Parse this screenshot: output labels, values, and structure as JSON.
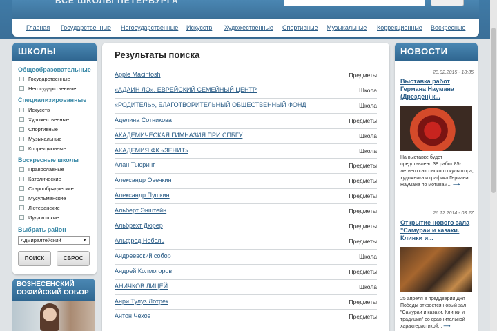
{
  "header": {
    "tagline": "ВСЕ ШКОЛЫ ПЕТЕРБУРГА",
    "search_value": "",
    "search_button": ""
  },
  "nav": [
    "Главная",
    "Государственные",
    "Негосударственные",
    "Искусств",
    "Художественные",
    "Спортивные",
    "Музыкальные",
    "Коррекционные",
    "Воскресные"
  ],
  "sidebar": {
    "title": "ШКОЛЫ",
    "groups": [
      {
        "title": "Общеобразовательные",
        "items": [
          "Государственные",
          "Негосударственные"
        ]
      },
      {
        "title": "Специализированные",
        "items": [
          "Искусств",
          "Художественные",
          "Спортивные",
          "Музыкальные",
          "Коррекционные"
        ]
      },
      {
        "title": "Воскресные школы",
        "items": [
          "Православные",
          "Католические",
          "Старообрядческие",
          "Мусульманские",
          "Лютеранские",
          "Иудаистские"
        ]
      }
    ],
    "district_label": "Выбрать район",
    "district_value": "Адмиралтейский",
    "search_button": "ПОИСК",
    "reset_button": "СБРОС"
  },
  "promo": {
    "title": "ВОЗНЕСЕНСКИЙ СОФИЙСКИЙ СОБОР"
  },
  "results": {
    "title": "Результаты поиска",
    "rows": [
      {
        "name": "Apple Macintosh",
        "type": "Предметы"
      },
      {
        "name": "«АДАИН ЛО», ЕВРЕЙСКИЙ СЕМЕЙНЫЙ ЦЕНТР",
        "type": "Школа"
      },
      {
        "name": "«РОДИТЕЛЬ», БЛАГОТВОРИТЕЛЬНЫЙ ОБЩЕСТВЕННЫЙ ФОНД",
        "type": "Школа"
      },
      {
        "name": "Аделина Сотникова",
        "type": "Предметы"
      },
      {
        "name": "АКАДЕМИЧЕСКАЯ ГИМНАЗИЯ ПРИ СПБГУ",
        "type": "Школа"
      },
      {
        "name": "АКАДЕМИЯ ФК «ЗЕНИТ»",
        "type": "Школа"
      },
      {
        "name": "Алан Тьюринг",
        "type": "Предметы"
      },
      {
        "name": "Александр Овечкин",
        "type": "Предметы"
      },
      {
        "name": "Александр Пушкин",
        "type": "Предметы"
      },
      {
        "name": "Альберт Энштейн",
        "type": "Предметы"
      },
      {
        "name": "Альбрехт Дюрер",
        "type": "Предметы"
      },
      {
        "name": "Альфред Нобель",
        "type": "Предметы"
      },
      {
        "name": "Андреевский собор",
        "type": "Школа"
      },
      {
        "name": "Андрей Колмогоров",
        "type": "Предметы"
      },
      {
        "name": "АНИЧКОВ ЛИЦЕЙ",
        "type": "Школа"
      },
      {
        "name": "Анри Тулуз Лотрек",
        "type": "Предметы"
      },
      {
        "name": "Антон Чехов",
        "type": "Предметы"
      }
    ]
  },
  "news": {
    "title": "НОВОСТИ",
    "items": [
      {
        "date": "23.02.2015 - 18:35",
        "title": "Выставка работ Германа Наумана (Дрезден) к...",
        "text": "На выставке будет представлено 38 работ 85-летнего саксонского скульптора, художника и графика Германа Наумана по мотивам...",
        "more": "⟶"
      },
      {
        "date": "26.12.2014 - 03:27",
        "title": "Открытие нового зала \"Самураи и казаки. Клинки и...",
        "text": "25 апреля в преддверии Дня Победы откроется новый зал \"Самураи и казаки. Клинки и традиции\" со сравнительной характеристикой...",
        "more": "⟶"
      }
    ]
  }
}
